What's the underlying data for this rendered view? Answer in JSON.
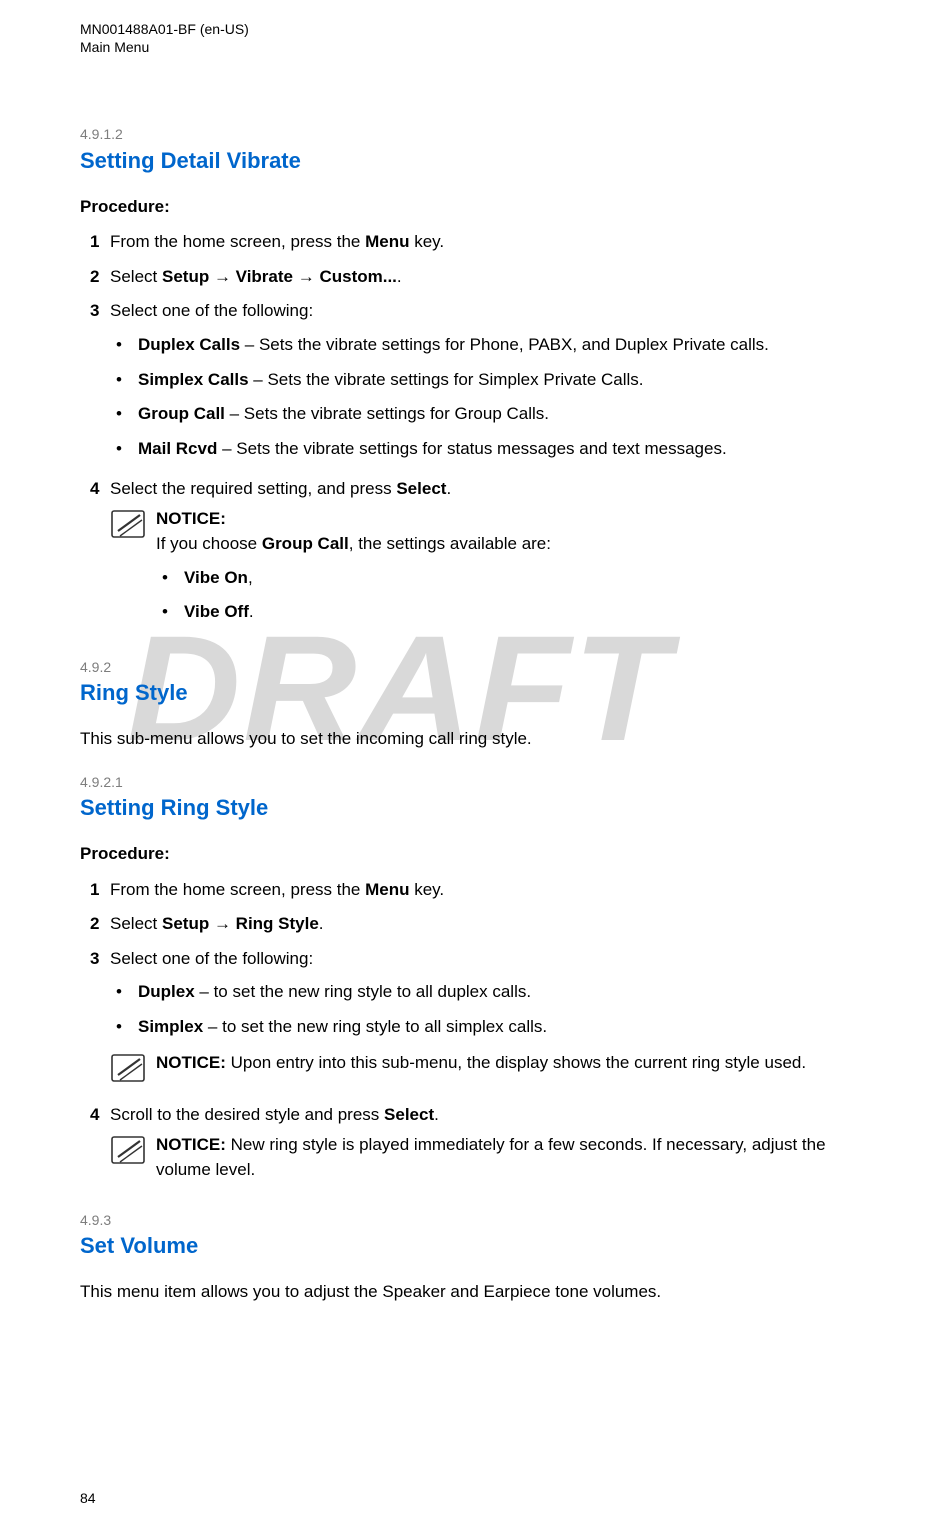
{
  "header": {
    "doc_id": "MN001488A01-BF (en-US)",
    "section": "Main Menu"
  },
  "watermark": "DRAFT",
  "page_number": "84",
  "s1": {
    "num": "4.9.1.2",
    "title": "Setting Detail Vibrate",
    "proc_label": "Procedure:",
    "steps": {
      "n1": "1",
      "t1a": "From the home screen, press the ",
      "t1b": "Menu",
      "t1c": " key.",
      "n2": "2",
      "t2a": "Select ",
      "t2b": "Setup",
      "t2c": " → ",
      "t2d": "Vibrate",
      "t2e": " → ",
      "t2f": "Custom...",
      "t2g": ".",
      "n3": "3",
      "t3": "Select one of the following:",
      "b1a": "Duplex Calls",
      "b1b": " – Sets the vibrate settings for Phone, PABX, and Duplex Private calls.",
      "b2a": "Simplex Calls",
      "b2b": " – Sets the vibrate settings for Simplex Private Calls.",
      "b3a": "Group Call",
      "b3b": " – Sets the vibrate settings for Group Calls.",
      "b4a": "Mail Rcvd",
      "b4b": " – Sets the vibrate settings for status messages and text messages.",
      "n4": "4",
      "t4a": "Select the required setting, and press ",
      "t4b": "Select",
      "t4c": ".",
      "notice_label": "NOTICE:",
      "notice_text_a": "If you choose ",
      "notice_text_b": "Group Call",
      "notice_text_c": ", the settings available are:",
      "nba": "Vibe On",
      "nbas": ",",
      "nbb": "Vibe Off",
      "nbbs": "."
    }
  },
  "s2": {
    "num": "4.9.2",
    "title": "Ring Style",
    "desc": "This sub-menu allows you to set the incoming call ring style."
  },
  "s3": {
    "num": "4.9.2.1",
    "title": "Setting Ring Style",
    "proc_label": "Procedure:",
    "steps": {
      "n1": "1",
      "t1a": "From the home screen, press the ",
      "t1b": "Menu",
      "t1c": " key.",
      "n2": "2",
      "t2a": "Select ",
      "t2b": "Setup",
      "t2c": " → ",
      "t2d": "Ring Style",
      "t2e": ".",
      "n3": "3",
      "t3": "Select one of the following:",
      "b1a": "Duplex",
      "b1b": " – to set the new ring style to all duplex calls.",
      "b2a": "Simplex",
      "b2b": " – to set the new ring style to all simplex calls.",
      "notice1_label": "NOTICE:",
      "notice1_text": " Upon entry into this sub-menu, the display shows the current ring style used.",
      "n4": "4",
      "t4a": "Scroll to the desired style and press ",
      "t4b": "Select",
      "t4c": ".",
      "notice2_label": "NOTICE:",
      "notice2_text": " New ring style is played immediately for a few seconds. If necessary, adjust the volume level."
    }
  },
  "s4": {
    "num": "4.9.3",
    "title": "Set Volume",
    "desc": "This menu item allows you to adjust the Speaker and Earpiece tone volumes."
  }
}
